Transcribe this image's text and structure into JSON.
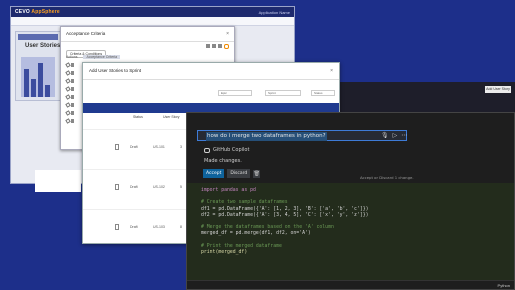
{
  "background_app": {
    "logo_part1": "CEVO",
    "logo_part2": "AppSphere",
    "title": "User Stories",
    "topnav_text": "Application Name"
  },
  "acceptance_dialog": {
    "title": "Acceptance Criteria",
    "close": "×",
    "pill": "Criteria & Conditions",
    "columns": [
      "Actions",
      "Acceptance Criteria"
    ]
  },
  "user_stories_dialog": {
    "title": "Add User Stories to Sprint",
    "close": "×",
    "filters": [
      "Epic",
      "Sprint",
      "Status",
      "Assignee"
    ],
    "columns": [
      "",
      "Status",
      "User Story",
      "Points"
    ],
    "rows": [
      {
        "status": "Draft",
        "id": "US-101",
        "points": "3"
      },
      {
        "status": "Draft",
        "id": "US-102",
        "points": "5"
      },
      {
        "status": "Draft",
        "id": "US-103",
        "points": "8"
      }
    ],
    "add_button": "Add User Story"
  },
  "editor": {
    "chat_prompt": "how do i merge two dataframes in python?",
    "copilot_name": "GitHub Copilot",
    "made_changes": "Made changes.",
    "accept_label": "Accept",
    "discard_label": "Discard",
    "hint": "Accept or Discard 1 change.",
    "language": "Python",
    "code_lines": [
      {
        "t": "kw",
        "text": "import pandas as pd"
      },
      {
        "t": "tx",
        "text": ""
      },
      {
        "t": "cm",
        "text": "# Create two sample dataframes"
      },
      {
        "t": "tx",
        "text": "df1 = pd.DataFrame({'A': [1, 2, 3], 'B': ['a', 'b', 'c']})"
      },
      {
        "t": "tx",
        "text": "df2 = pd.DataFrame({'A': [3, 4, 5], 'C': ['x', 'y', 'z']})"
      },
      {
        "t": "tx",
        "text": ""
      },
      {
        "t": "cm",
        "text": "# Merge the dataframes based on the 'A' column"
      },
      {
        "t": "tx",
        "text": "merged_df = pd.merge(df1, df2, on='A')"
      },
      {
        "t": "tx",
        "text": ""
      },
      {
        "t": "cm",
        "text": "# Print the merged dataframe"
      },
      {
        "t": "fn",
        "text": "print(merged_df)"
      }
    ]
  },
  "colors": {
    "desktop": "#1d2f8a",
    "accept_button": "#0e639c",
    "prompt_highlight": "#264f78"
  }
}
